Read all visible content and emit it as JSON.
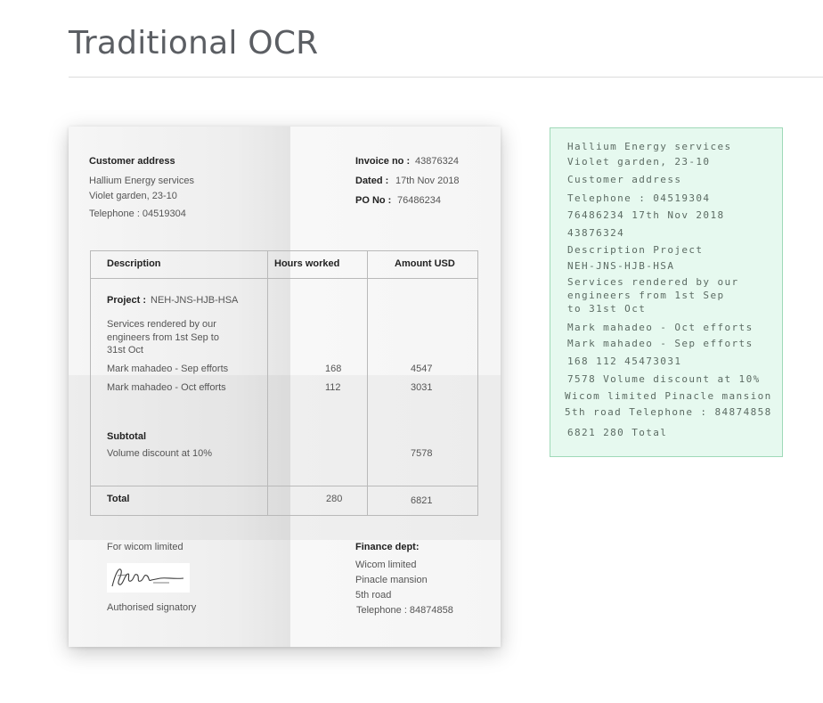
{
  "page": {
    "title": "Traditional OCR"
  },
  "invoice": {
    "customer": {
      "heading": "Customer address",
      "name": "Hallium Energy services",
      "address": "Violet garden, 23-10",
      "phone": "Telephone : 04519304"
    },
    "meta": {
      "invoice_label": "Invoice no :",
      "invoice_value": "43876324",
      "dated_label": "Dated :",
      "dated_value": "17th Nov 2018",
      "po_label": "PO No :",
      "po_value": "76486234"
    },
    "table": {
      "headers": {
        "description": "Description",
        "hours": "Hours worked",
        "amount": "Amount USD"
      },
      "project_label": "Project :",
      "project_value": "NEH-JNS-HJB-HSA",
      "services": [
        "Services rendered by our",
        "engineers from 1st Sep to",
        "31st Oct"
      ],
      "rows": [
        {
          "description": "Mark mahadeo - Sep efforts",
          "hours": "168",
          "amount": "4547"
        },
        {
          "description": "Mark mahadeo - Oct efforts",
          "hours": "112",
          "amount": "3031"
        }
      ],
      "subtotal_label": "Subtotal",
      "discount_label": "Volume discount at 10%",
      "discount_amount": "7578",
      "total_label": "Total",
      "total_hours": "280",
      "total_amount": "6821"
    },
    "footer": {
      "for_label": "For wicom limited",
      "signature_text": "Signature",
      "signatory": "Authorised signatory",
      "finance_heading": "Finance dept:",
      "finance_lines": [
        "Wicom limited",
        "Pinacle mansion",
        "5th road",
        "Telephone : 84874858"
      ]
    }
  },
  "ocr_output": {
    "lines": [
      "Hallium Energy services",
      "Violet garden, 23-10",
      "Customer address",
      "Telephone : 04519304",
      "76486234 17th Nov 2018",
      "43876324",
      "Description Project",
      "NEH-JNS-HJB-HSA",
      "Services rendered by our",
      "engineers from 1st Sep",
      "to 31st Oct",
      "Mark mahadeo - Oct efforts",
      "Mark mahadeo - Sep efforts",
      "168 112 45473031",
      "7578 Volume discount at 10%",
      "Wicom limited Pinacle mansion",
      "5th road Telephone : 84874858",
      "6821 280 Total"
    ]
  }
}
